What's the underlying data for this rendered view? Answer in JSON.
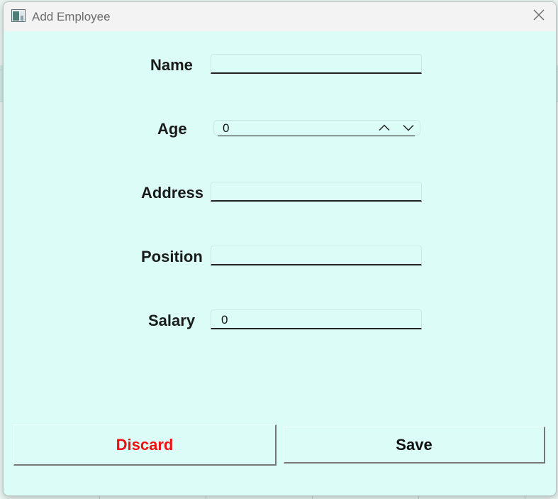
{
  "window": {
    "title": "Add Employee"
  },
  "form": {
    "name_label": "Name",
    "name_value": "",
    "age_label": "Age",
    "age_value": "0",
    "address_label": "Address",
    "address_value": "",
    "position_label": "Position",
    "position_value": "",
    "salary_label": "Salary",
    "salary_value": "0"
  },
  "buttons": {
    "discard_label": "Discard",
    "save_label": "Save"
  },
  "colors": {
    "dialog_background": "#dbfcf7",
    "discard_text": "#ee1111",
    "titlebar": "#f3f3f3"
  },
  "icons": {
    "app": "window-app-icon",
    "close": "close-icon",
    "increment": "chevron-up-icon",
    "decrement": "chevron-down-icon"
  }
}
